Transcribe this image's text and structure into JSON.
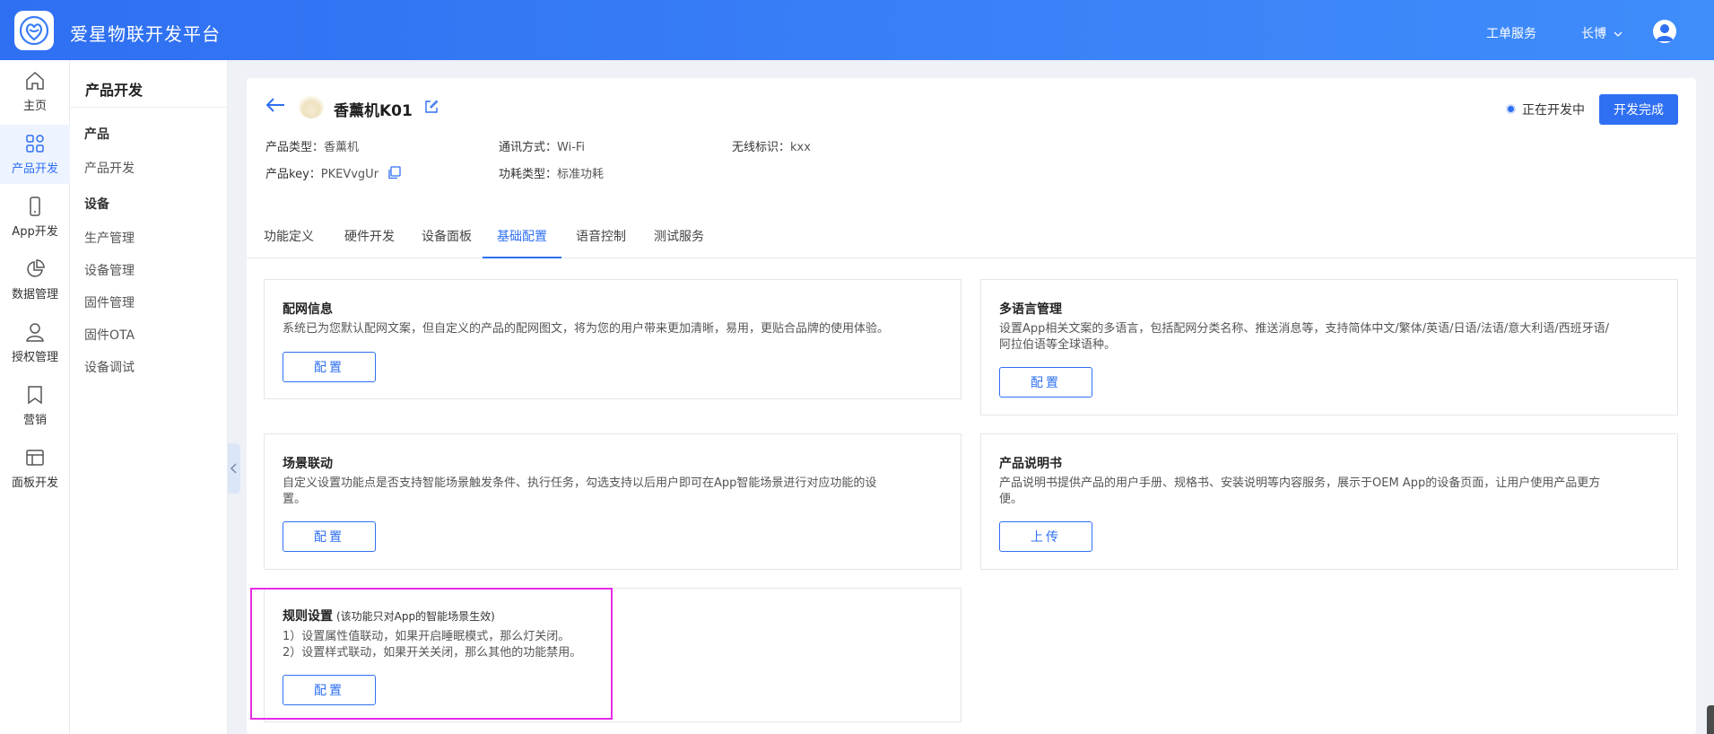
{
  "header": {
    "app_title": "爱星物联开发平台",
    "ticket_service": "工单服务",
    "username": "长博"
  },
  "rail": [
    {
      "label": "主页",
      "icon": "home-icon"
    },
    {
      "label": "产品开发",
      "icon": "grid-icon",
      "active": true
    },
    {
      "label": "App开发",
      "icon": "phone-icon"
    },
    {
      "label": "数据管理",
      "icon": "pie-chart-icon"
    },
    {
      "label": "授权管理",
      "icon": "user-icon"
    },
    {
      "label": "营销",
      "icon": "bookmark-icon"
    },
    {
      "label": "面板开发",
      "icon": "panel-icon"
    }
  ],
  "subnav": {
    "title": "产品开发",
    "groups": [
      {
        "label": "产品",
        "items": [
          "产品开发"
        ]
      },
      {
        "label": "设备",
        "items": [
          "生产管理",
          "设备管理",
          "固件管理",
          "固件OTA",
          "设备调试"
        ]
      }
    ]
  },
  "product": {
    "name": "香薰机K01",
    "status": "正在开发中",
    "done_button": "开发完成",
    "meta": {
      "type_label": "产品类型：",
      "type_value": "香薰机",
      "comm_label": "通讯方式：",
      "comm_value": "Wi-Fi",
      "wireless_label": "无线标识：",
      "wireless_value": "kxx",
      "key_label": "产品key：",
      "key_value": "PKEVvgUr",
      "power_label": "功耗类型：",
      "power_value": "标准功耗"
    }
  },
  "tabs": [
    "功能定义",
    "硬件开发",
    "设备面板",
    "基础配置",
    "语音控制",
    "测试服务"
  ],
  "active_tab": 3,
  "cards": {
    "network": {
      "title": "配网信息",
      "desc": "系统已为您默认配网文案，但自定义的产品的配网图文，将为您的用户带来更加清晰，易用，更贴合品牌的使用体验。",
      "button": "配置"
    },
    "language": {
      "title": "多语言管理",
      "desc1": "设置App相关文案的多语言，包括配网分类名称、推送消息等，支持简体中文/繁体/英语/日语/法语/意大利语/西班牙语/",
      "desc2": "阿拉伯语等全球语种。",
      "button": "配置"
    },
    "scene": {
      "title": "场景联动",
      "desc1": "自定义设置功能点是否支持智能场景触发条件、执行任务，勾选支持以后用户即可在App智能场景进行对应功能的设",
      "desc2": "置。",
      "button": "配置"
    },
    "manual": {
      "title": "产品说明书",
      "desc1": "产品说明书提供产品的用户手册、规格书、安装说明等内容服务，展示于OEM App的设备页面，让用户使用产品更方",
      "desc2": "便。",
      "button": "上传"
    },
    "rules": {
      "title": "规则设置",
      "note": "(该功能只对App的智能场景生效)",
      "line1": "1）设置属性值联动，如果开启睡眠模式，那么灯关闭。",
      "line2": "2）设置样式联动，如果开关关闭，那么其他的功能禁用。",
      "button": "配置"
    }
  },
  "colors": {
    "accent": "#2f6ff2",
    "highlight": "#e62ce6"
  }
}
